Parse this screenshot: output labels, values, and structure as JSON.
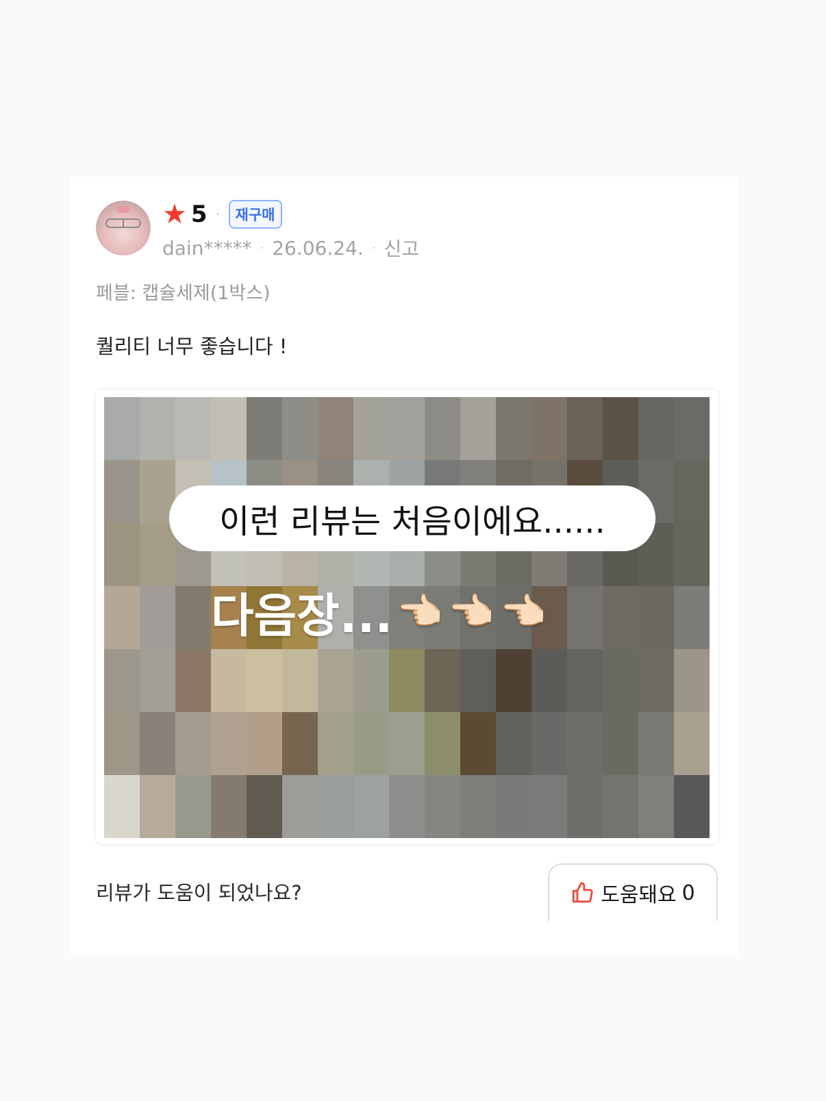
{
  "review": {
    "rating_value": "5",
    "badge": "재구매",
    "username": "dain*****",
    "date": "26.06.24.",
    "report_label": "신고",
    "option_text": "페블: 캡슐세제(1박스)",
    "body_text": "퀄리티 너무 좋습니다 !",
    "icons": {
      "star": "star-icon",
      "thumb": "thumbs-up-icon",
      "hand": "pointing-hand-icon"
    }
  },
  "photo": {
    "bubble_text": "이런 리뷰는 처음이에요......",
    "overlay_text": "다음장...",
    "hands": [
      "👉🏻",
      "👉🏻",
      "👉🏻"
    ],
    "mosaic_colors": [
      "#a9aaaa",
      "#b2b1ac",
      "#bab9b4",
      "#c3beb4",
      "#7d7c77",
      "#8e8d88",
      "#928378",
      "#a3a29a",
      "#a3a29c",
      "#8c8b86",
      "#a5a099",
      "#7b776c",
      "#7e7366",
      "#6a6157",
      "#5c5348",
      "#676761",
      "#6b6b65",
      "#9a958a",
      "#aaa290",
      "#c3bfb4",
      "#b7c2c6",
      "#8c8d85",
      "#9a9085",
      "#88857e",
      "#adb1ad",
      "#9ea3a3",
      "#777978",
      "#81807b",
      "#6f6c63",
      "#76726a",
      "#5a4c3f",
      "#5e5e58",
      "#6b6b66",
      "#66665e",
      "#9e9482",
      "#a59c88",
      "#9d998f",
      "#c2c2ba",
      "#c1bdb2",
      "#b9b3a6",
      "#b1b0a8",
      "#b3b7b3",
      "#a9aeab",
      "#8b8e89",
      "#7b7b74",
      "#6c6b64",
      "#7e7c75",
      "#6a6963",
      "#595952",
      "#5e5d56",
      "#65645d",
      "#b5a796",
      "#a19c98",
      "#827b70",
      "#a7824f",
      "#8f7536",
      "#a78b49",
      "#aeb0ab",
      "#8e918d",
      "#7f807a",
      "#7c7c77",
      "#72726d",
      "#6e6e68",
      "#6a5b4d",
      "#74736e",
      "#6d6b64",
      "#6c6a5e",
      "#7d7c76",
      "#9b978b",
      "#a29e97",
      "#8d7767",
      "#c7b8a0",
      "#cdbea0",
      "#c2b99c",
      "#a8a393",
      "#9c9d8e",
      "#8c8a5e",
      "#6d6555",
      "#5f5e58",
      "#4e4033",
      "#5b5c57",
      "#62645f",
      "#6a6a61",
      "#6e6c61",
      "#9c958a",
      "#9f9687",
      "#8a8278",
      "#a49c91",
      "#b0a090",
      "#b29e89",
      "#77654f",
      "#a3a18c",
      "#9a9b87",
      "#9c9e8e",
      "#8c8d6a",
      "#5c4a33",
      "#62625c",
      "#686a68",
      "#6f6f6a",
      "#6b6a61",
      "#797a76",
      "#a9a18f",
      "#d9d7cd",
      "#b7ab9d",
      "#9a998e",
      "#847a6e",
      "#605c52",
      "#9d9c99",
      "#9a9d9d",
      "#9da1a0",
      "#8e8f8c",
      "#848682",
      "#7d7e7a",
      "#7a7a78",
      "#7b7b79",
      "#6d6e6a",
      "#737370",
      "#7e807b",
      "#585857"
    ]
  },
  "footer": {
    "question": "리뷰가 도움이 되었나요?",
    "helpful_label": "도움돼요",
    "helpful_count": "0"
  }
}
